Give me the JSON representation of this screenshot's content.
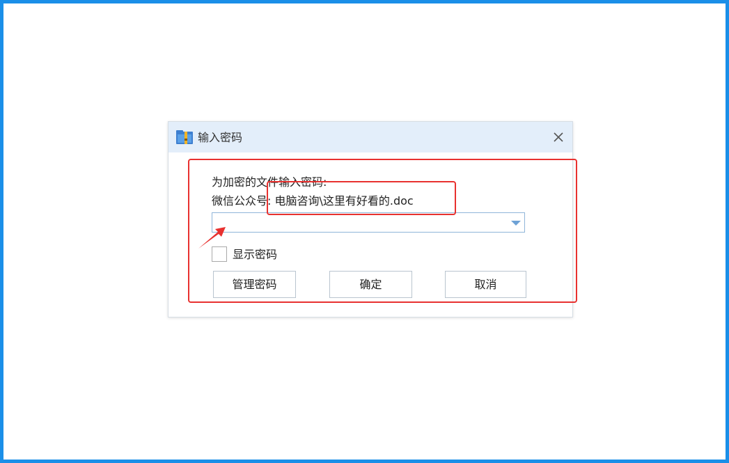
{
  "dialog": {
    "title": "输入密码",
    "app_icon": "winrar-archive-icon",
    "close_icon": "close-icon"
  },
  "form": {
    "prompt": "为加密的文件输入密码:",
    "file_path": "微信公众号: 电脑咨询\\这里有好看的.doc",
    "password_value": "",
    "dropdown_icon": "triangle-down-icon",
    "show_password_label": "显示密码",
    "show_password_checked": false
  },
  "buttons": {
    "manage_label": "管理密码",
    "ok_label": "确定",
    "cancel_label": "取消"
  },
  "colors": {
    "frame_border": "#1b8fe8",
    "titlebar_bg": "#e3eefa",
    "annotation_red": "#e8312f",
    "combo_border": "#8fb5d9",
    "dropdown_arrow": "#6ea2d6"
  }
}
